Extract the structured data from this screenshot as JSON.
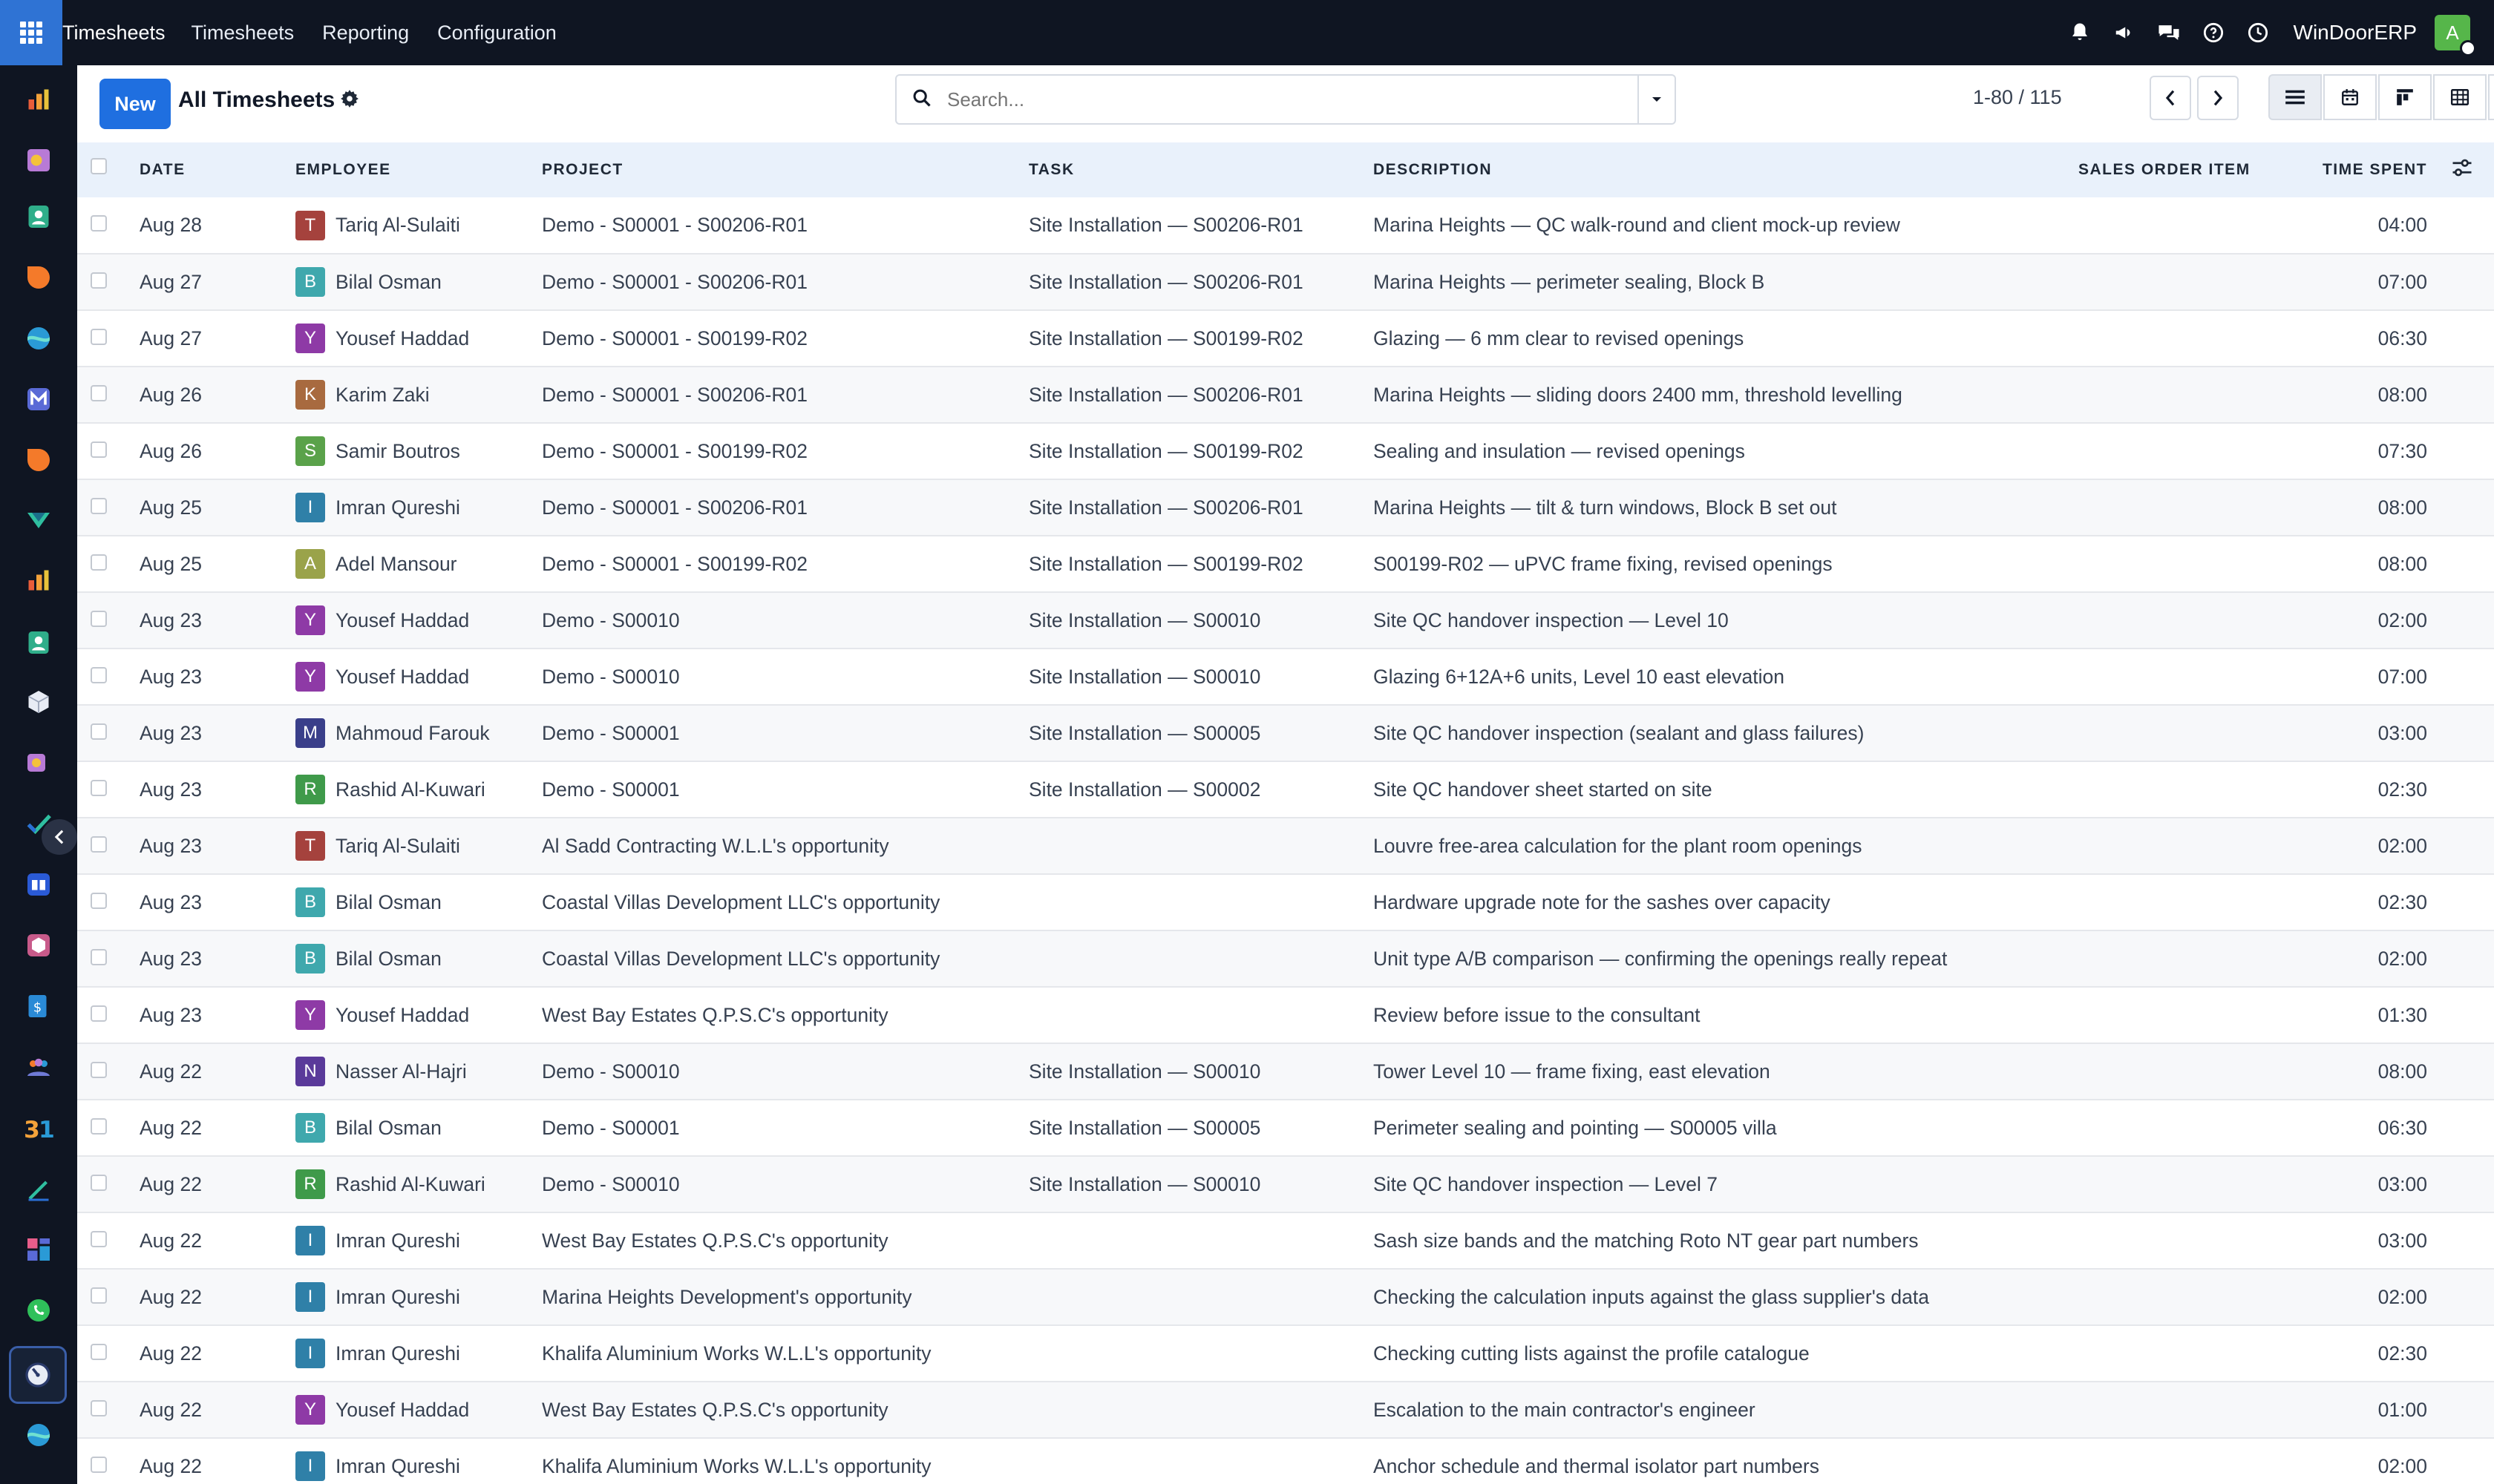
{
  "topbar": {
    "app_name": "Timesheets",
    "menu": [
      "Timesheets",
      "Reporting",
      "Configuration"
    ],
    "company": "WinDoorERP",
    "user_initial": "A"
  },
  "sidebar": {
    "icons": [
      "sales-icon",
      "inventory-icon",
      "contacts-icon",
      "crm-icon",
      "website-icon",
      "email-marketing-icon",
      "discuss-icon",
      "helpdesk-icon",
      "reporting-icon",
      "employees-icon",
      "manufacturing-icon",
      "purchase-icon",
      "project-icon",
      "knowledge-icon",
      "product-icon",
      "invoicing-icon",
      "team-icon",
      "calendar-icon",
      "sign-icon",
      "dashboards-icon",
      "whatsapp-icon",
      "timesheets-icon",
      "website-builder-icon"
    ],
    "active": "timesheets-icon"
  },
  "controlbar": {
    "new_label": "New",
    "title": "All Timesheets",
    "search_placeholder": "Search...",
    "pager": "1-80 / 115"
  },
  "table": {
    "headers": {
      "date": "DATE",
      "employee": "EMPLOYEE",
      "project": "PROJECT",
      "task": "TASK",
      "description": "DESCRIPTION",
      "sales_order_item": "SALES ORDER ITEM",
      "time_spent": "TIME SPENT"
    },
    "rows": [
      {
        "date": "Aug 28",
        "initial": "T",
        "color": "#a5423d",
        "employee": "Tariq Al-Sulaiti",
        "project": "Demo - S00001 - S00206-R01",
        "task": "Site Installation — S00206-R01",
        "description": "Marina Heights — QC walk-round and client mock-up review",
        "time": "04:00"
      },
      {
        "date": "Aug 27",
        "initial": "B",
        "color": "#3fa8ad",
        "employee": "Bilal Osman",
        "project": "Demo - S00001 - S00206-R01",
        "task": "Site Installation — S00206-R01",
        "description": "Marina Heights — perimeter sealing, Block B",
        "time": "07:00"
      },
      {
        "date": "Aug 27",
        "initial": "Y",
        "color": "#8e3aa6",
        "employee": "Yousef Haddad",
        "project": "Demo - S00001 - S00199-R02",
        "task": "Site Installation — S00199-R02",
        "description": "Glazing — 6 mm clear to revised openings",
        "time": "06:30"
      },
      {
        "date": "Aug 26",
        "initial": "K",
        "color": "#a86a3f",
        "employee": "Karim Zaki",
        "project": "Demo - S00001 - S00206-R01",
        "task": "Site Installation — S00206-R01",
        "description": "Marina Heights — sliding doors 2400 mm, threshold levelling",
        "time": "08:00"
      },
      {
        "date": "Aug 26",
        "initial": "S",
        "color": "#5aa24a",
        "employee": "Samir Boutros",
        "project": "Demo - S00001 - S00199-R02",
        "task": "Site Installation — S00199-R02",
        "description": "Sealing and insulation — revised openings",
        "time": "07:30"
      },
      {
        "date": "Aug 25",
        "initial": "I",
        "color": "#2f80a8",
        "employee": "Imran Qureshi",
        "project": "Demo - S00001 - S00206-R01",
        "task": "Site Installation — S00206-R01",
        "description": "Marina Heights — tilt & turn windows, Block B set out",
        "time": "08:00"
      },
      {
        "date": "Aug 25",
        "initial": "A",
        "color": "#9aa34a",
        "employee": "Adel Mansour",
        "project": "Demo - S00001 - S00199-R02",
        "task": "Site Installation — S00199-R02",
        "description": "S00199-R02 — uPVC frame fixing, revised openings",
        "time": "08:00"
      },
      {
        "date": "Aug 23",
        "initial": "Y",
        "color": "#8e3aa6",
        "employee": "Yousef Haddad",
        "project": "Demo - S00010",
        "task": "Site Installation — S00010",
        "description": "Site QC handover inspection — Level 10",
        "time": "02:00"
      },
      {
        "date": "Aug 23",
        "initial": "Y",
        "color": "#8e3aa6",
        "employee": "Yousef Haddad",
        "project": "Demo - S00010",
        "task": "Site Installation — S00010",
        "description": "Glazing 6+12A+6 units, Level 10 east elevation",
        "time": "07:00"
      },
      {
        "date": "Aug 23",
        "initial": "M",
        "color": "#3a3f8a",
        "employee": "Mahmoud Farouk",
        "project": "Demo - S00001",
        "task": "Site Installation — S00005",
        "description": "Site QC handover inspection (sealant and glass failures)",
        "time": "03:00"
      },
      {
        "date": "Aug 23",
        "initial": "R",
        "color": "#3f9a4a",
        "employee": "Rashid Al-Kuwari",
        "project": "Demo - S00001",
        "task": "Site Installation — S00002",
        "description": "Site QC handover sheet started on site",
        "time": "02:30"
      },
      {
        "date": "Aug 23",
        "initial": "T",
        "color": "#a5423d",
        "employee": "Tariq Al-Sulaiti",
        "project": "Al Sadd Contracting W.L.L's opportunity",
        "task": "",
        "description": "Louvre free-area calculation for the plant room openings",
        "time": "02:00"
      },
      {
        "date": "Aug 23",
        "initial": "B",
        "color": "#3fa8ad",
        "employee": "Bilal Osman",
        "project": "Coastal Villas Development LLC's opportunity",
        "task": "",
        "description": "Hardware upgrade note for the sashes over capacity",
        "time": "02:30"
      },
      {
        "date": "Aug 23",
        "initial": "B",
        "color": "#3fa8ad",
        "employee": "Bilal Osman",
        "project": "Coastal Villas Development LLC's opportunity",
        "task": "",
        "description": "Unit type A/B comparison — confirming the openings really repeat",
        "time": "02:00"
      },
      {
        "date": "Aug 23",
        "initial": "Y",
        "color": "#8e3aa6",
        "employee": "Yousef Haddad",
        "project": "West Bay Estates Q.P.S.C's opportunity",
        "task": "",
        "description": "Review before issue to the consultant",
        "time": "01:30"
      },
      {
        "date": "Aug 22",
        "initial": "N",
        "color": "#5a3a9a",
        "employee": "Nasser Al-Hajri",
        "project": "Demo - S00010",
        "task": "Site Installation — S00010",
        "description": "Tower Level 10 — frame fixing, east elevation",
        "time": "08:00"
      },
      {
        "date": "Aug 22",
        "initial": "B",
        "color": "#3fa8ad",
        "employee": "Bilal Osman",
        "project": "Demo - S00001",
        "task": "Site Installation — S00005",
        "description": "Perimeter sealing and pointing — S00005 villa",
        "time": "06:30"
      },
      {
        "date": "Aug 22",
        "initial": "R",
        "color": "#3f9a4a",
        "employee": "Rashid Al-Kuwari",
        "project": "Demo - S00010",
        "task": "Site Installation — S00010",
        "description": "Site QC handover inspection — Level 7",
        "time": "03:00"
      },
      {
        "date": "Aug 22",
        "initial": "I",
        "color": "#2f80a8",
        "employee": "Imran Qureshi",
        "project": "West Bay Estates Q.P.S.C's opportunity",
        "task": "",
        "description": "Sash size bands and the matching Roto NT gear part numbers",
        "time": "03:00"
      },
      {
        "date": "Aug 22",
        "initial": "I",
        "color": "#2f80a8",
        "employee": "Imran Qureshi",
        "project": "Marina Heights Development's opportunity",
        "task": "",
        "description": "Checking the calculation inputs against the glass supplier's data",
        "time": "02:00"
      },
      {
        "date": "Aug 22",
        "initial": "I",
        "color": "#2f80a8",
        "employee": "Imran Qureshi",
        "project": "Khalifa Aluminium Works W.L.L's opportunity",
        "task": "",
        "description": "Checking cutting lists against the profile catalogue",
        "time": "02:30"
      },
      {
        "date": "Aug 22",
        "initial": "Y",
        "color": "#8e3aa6",
        "employee": "Yousef Haddad",
        "project": "West Bay Estates Q.P.S.C's opportunity",
        "task": "",
        "description": "Escalation to the main contractor's engineer",
        "time": "01:00"
      },
      {
        "date": "Aug 22",
        "initial": "I",
        "color": "#2f80a8",
        "employee": "Imran Qureshi",
        "project": "Khalifa Aluminium Works W.L.L's opportunity",
        "task": "",
        "description": "Anchor schedule and thermal isolator part numbers",
        "time": "02:00"
      }
    ]
  }
}
